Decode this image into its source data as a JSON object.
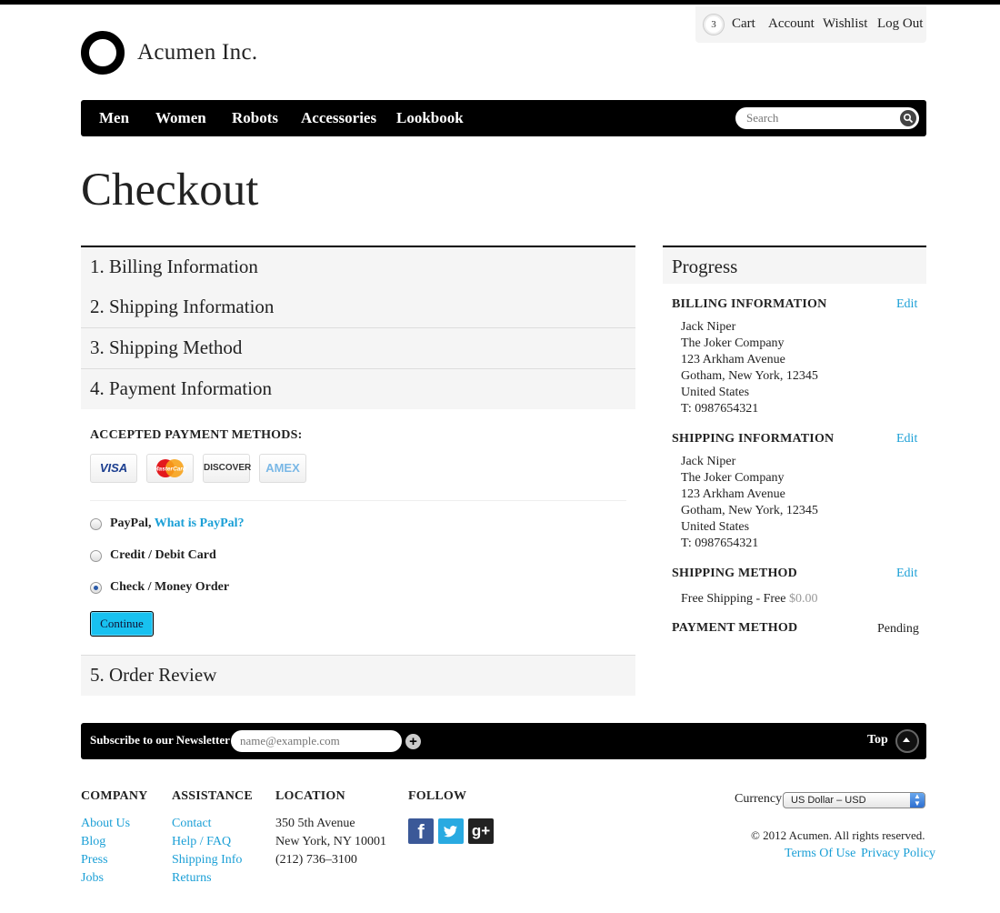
{
  "utility": {
    "cart_count": "3",
    "cart": "Cart",
    "account": "Account",
    "wishlist": "Wishlist",
    "logout": "Log Out"
  },
  "brand": {
    "name": "Acumen Inc."
  },
  "nav": {
    "items": [
      "Men",
      "Women",
      "Robots",
      "Accessories",
      "Lookbook"
    ],
    "search_placeholder": "Search"
  },
  "page": {
    "title": "Checkout"
  },
  "steps": [
    "1. Billing Information",
    "2. Shipping Information",
    "3. Shipping Method",
    "4. Payment Information",
    "5. Order Review"
  ],
  "payment": {
    "accepted_label": "ACCEPTED PAYMENT METHODS:",
    "cards": [
      "VISA",
      "MasterCard",
      "DISCOVER",
      "AMEX"
    ],
    "options": [
      {
        "label": "PayPal,",
        "link": "What is PayPal?",
        "selected": false
      },
      {
        "label": "Credit / Debit Card",
        "selected": false
      },
      {
        "label": "Check / Money Order",
        "selected": true
      }
    ],
    "continue": "Continue"
  },
  "progress": {
    "title": "Progress",
    "edit": "Edit",
    "billing": {
      "title": "BILLING INFORMATION",
      "lines": [
        "Jack Niper",
        "The Joker Company",
        "123 Arkham Avenue",
        "Gotham, New York, 12345",
        "United States",
        "T: 0987654321"
      ]
    },
    "shipping": {
      "title": "SHIPPING INFORMATION",
      "lines": [
        "Jack Niper",
        "The Joker Company",
        "123 Arkham Avenue",
        "Gotham, New York, 12345",
        "United States",
        "T: 0987654321"
      ]
    },
    "method": {
      "title": "SHIPPING METHOD",
      "text": "Free Shipping - Free",
      "price": "$0.00"
    },
    "payment": {
      "title": "PAYMENT METHOD",
      "status": "Pending"
    }
  },
  "newsletter": {
    "label": "Subscribe to our Newsletter",
    "placeholder": "name@example.com",
    "top": "Top"
  },
  "footer": {
    "company": {
      "title": "COMPANY",
      "links": [
        "About Us",
        "Blog",
        "Press",
        "Jobs"
      ]
    },
    "assistance": {
      "title": "ASSISTANCE",
      "links": [
        "Contact",
        "Help / FAQ",
        "Shipping Info",
        "Returns"
      ]
    },
    "location": {
      "title": "LOCATION",
      "lines": [
        "350 5th Avenue",
        "New York, NY 10001",
        "(212) 736–3100"
      ]
    },
    "follow": {
      "title": "FOLLOW",
      "icons": [
        "facebook-icon",
        "twitter-icon",
        "google-plus-icon"
      ]
    },
    "currency_label": "Currency",
    "currency_value": "US Dollar – USD",
    "copyright": "© 2012 Acumen. All rights reserved.",
    "terms": "Terms Of Use",
    "privacy": "Privacy Policy"
  },
  "colors": {
    "accent": "#1a9fd6",
    "button": "#18c1f0",
    "bar": "#000000"
  }
}
